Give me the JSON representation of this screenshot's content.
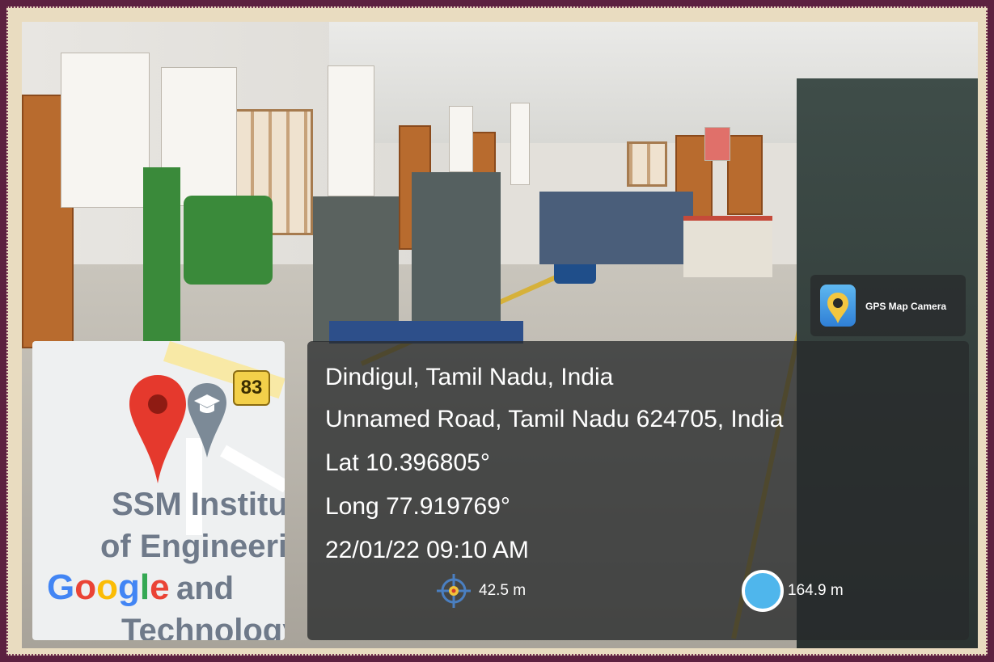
{
  "location": {
    "city_line": "Dindigul, Tamil Nadu, India",
    "address_line": "Unnamed Road, Tamil Nadu 624705, India",
    "latitude": "Lat 10.396805°",
    "longitude": "Long 77.919769°",
    "datetime": "22/01/22 09:10 AM"
  },
  "metrics": {
    "accuracy": "42.5 m",
    "altitude": "164.9 m"
  },
  "app": {
    "name": "GPS Map Camera",
    "icon": "gps-map-camera-icon"
  },
  "map": {
    "road_shield": "83",
    "place_label_lines": [
      "SSM Institute",
      "of Engineering",
      "and",
      "Technology"
    ],
    "brand_letters": [
      "G",
      "o",
      "o",
      "g",
      "l",
      "e"
    ],
    "pin_icon": "map-pin-icon",
    "school_icon": "graduation-cap-icon"
  },
  "colors": {
    "frame": "#5c2140",
    "pin": "#e5392d",
    "panel": "#2a2c2e"
  }
}
